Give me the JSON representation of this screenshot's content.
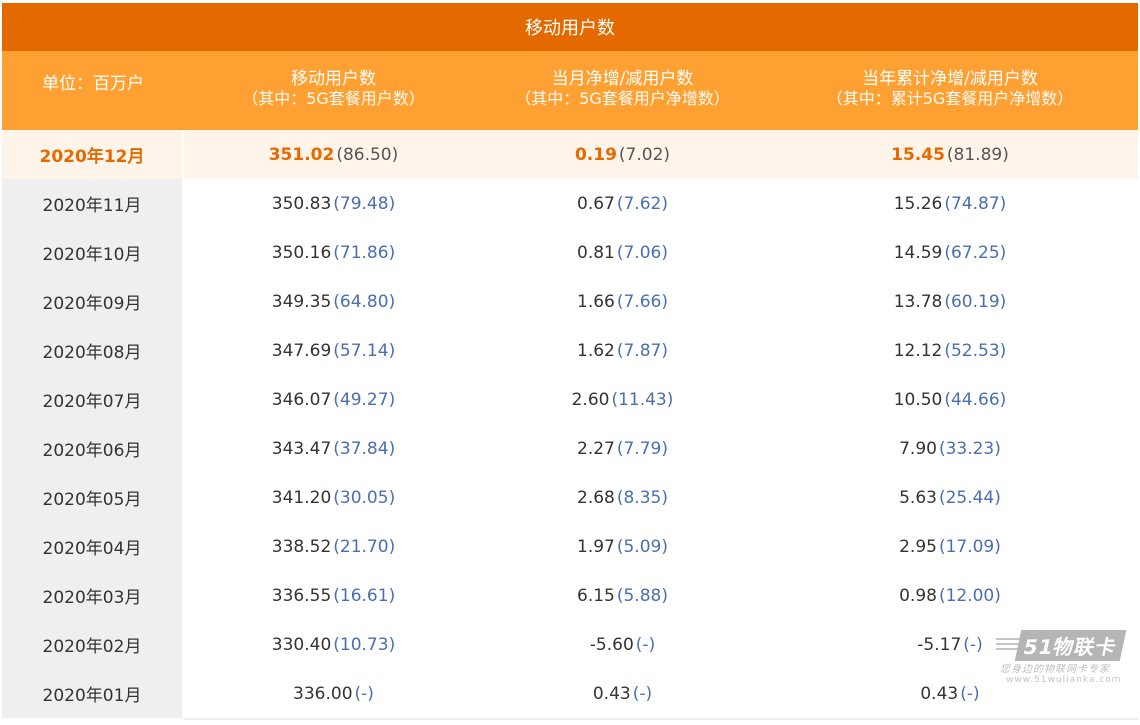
{
  "header": {
    "title": "移动用户数",
    "unit": "单位：百万户",
    "col1_line1": "移动用户数",
    "col1_line2": "（其中：5G套餐用户数）",
    "col2_line1": "当月净增/减用户数",
    "col2_line2": "（其中：5G套餐用户净增数）",
    "col3_line1": "当年累计净增/减用户数",
    "col3_line2": "（其中：累计5G套餐用户净增数）"
  },
  "chart_data": {
    "type": "table",
    "title": "移动用户数",
    "unit": "单位：百万户",
    "columns": [
      "移动用户数（其中：5G套餐用户数）",
      "当月净增/减用户数（其中：5G套餐用户净增数）",
      "当年累计净增/减用户数（其中：累计5G套餐用户净增数）"
    ],
    "rows": [
      {
        "month": "2020年12月",
        "v1": "351.02",
        "s1": "(86.50)",
        "v2": "0.19",
        "s2": "(7.02)",
        "v3": "15.45",
        "s3": "(81.89)",
        "highlight": true
      },
      {
        "month": "2020年11月",
        "v1": "350.83",
        "s1": "(79.48)",
        "v2": "0.67",
        "s2": "(7.62)",
        "v3": "15.26",
        "s3": "(74.87)"
      },
      {
        "month": "2020年10月",
        "v1": "350.16",
        "s1": "(71.86)",
        "v2": "0.81",
        "s2": "(7.06)",
        "v3": "14.59",
        "s3": "(67.25)"
      },
      {
        "month": "2020年09月",
        "v1": "349.35",
        "s1": "(64.80)",
        "v2": "1.66",
        "s2": "(7.66)",
        "v3": "13.78",
        "s3": "(60.19)"
      },
      {
        "month": "2020年08月",
        "v1": "347.69",
        "s1": "(57.14)",
        "v2": "1.62",
        "s2": "(7.87)",
        "v3": "12.12",
        "s3": "(52.53)"
      },
      {
        "month": "2020年07月",
        "v1": "346.07",
        "s1": "(49.27)",
        "v2": "2.60",
        "s2": "(11.43)",
        "v3": "10.50",
        "s3": "(44.66)"
      },
      {
        "month": "2020年06月",
        "v1": "343.47",
        "s1": "(37.84)",
        "v2": "2.27",
        "s2": "(7.79)",
        "v3": "7.90",
        "s3": "(33.23)"
      },
      {
        "month": "2020年05月",
        "v1": "341.20",
        "s1": "(30.05)",
        "v2": "2.68",
        "s2": "(8.35)",
        "v3": "5.63",
        "s3": "(25.44)"
      },
      {
        "month": "2020年04月",
        "v1": "338.52",
        "s1": "(21.70)",
        "v2": "1.97",
        "s2": "(5.09)",
        "v3": "2.95",
        "s3": "(17.09)"
      },
      {
        "month": "2020年03月",
        "v1": "336.55",
        "s1": "(16.61)",
        "v2": "6.15",
        "s2": "(5.88)",
        "v3": "0.98",
        "s3": "(12.00)"
      },
      {
        "month": "2020年02月",
        "v1": "330.40",
        "s1": "(10.73)",
        "v2": "-5.60",
        "s2": "(-)",
        "v3": "-5.17",
        "s3": "(-)"
      },
      {
        "month": "2020年01月",
        "v1": "336.00",
        "s1": "(-)",
        "v2": "0.43",
        "s2": "(-)",
        "v3": "0.43",
        "s3": "(-)"
      }
    ]
  },
  "watermark": {
    "brand": "51物联卡",
    "slogan": "您身边的物联网卡专家",
    "url": "www.51wulianka.com"
  },
  "colors": {
    "title_bg": "#e46a00",
    "header_bg": "#ffa033",
    "highlight_bg": "#fff4ea",
    "highlight_text": "#e46a00",
    "sub_value": "#4a6fb0"
  }
}
